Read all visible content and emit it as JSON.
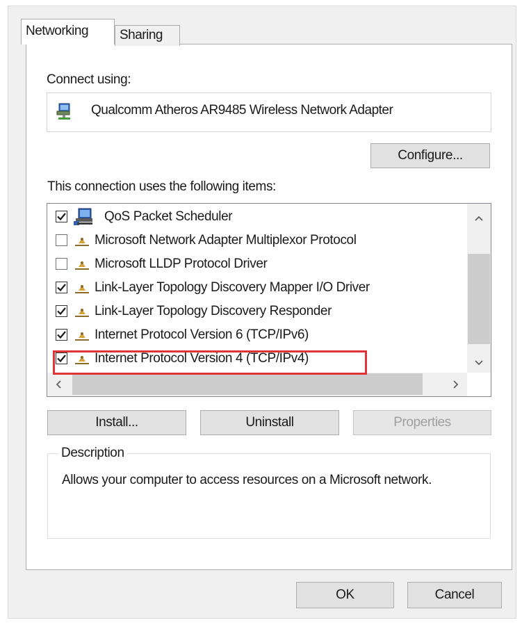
{
  "tabs": [
    {
      "label": "Networking",
      "active": true
    },
    {
      "label": "Sharing",
      "active": false
    }
  ],
  "connect_using": {
    "label": "Connect using:",
    "adapter_name": "Qualcomm Atheros AR9485 Wireless Network Adapter",
    "adapter_icon": "network-adapter-icon",
    "configure_label": "Configure..."
  },
  "items_section": {
    "label": "This connection uses the following items:",
    "items": [
      {
        "label": "QoS Packet Scheduler",
        "checked": true,
        "icon": "qos-scheduler-icon"
      },
      {
        "label": "Microsoft Network Adapter Multiplexor Protocol",
        "checked": false,
        "icon": "protocol-icon"
      },
      {
        "label": "Microsoft LLDP Protocol Driver",
        "checked": false,
        "icon": "protocol-icon"
      },
      {
        "label": "Link-Layer Topology Discovery Mapper I/O Driver",
        "checked": true,
        "icon": "protocol-icon"
      },
      {
        "label": "Link-Layer Topology Discovery Responder",
        "checked": true,
        "icon": "protocol-icon"
      },
      {
        "label": "Internet Protocol Version 6 (TCP/IPv6)",
        "checked": true,
        "icon": "protocol-icon"
      },
      {
        "label": "Internet Protocol Version 4 (TCP/IPv4)",
        "checked": true,
        "icon": "protocol-icon",
        "highlighted": true
      }
    ],
    "highlight_color": "#e0333a"
  },
  "buttons": {
    "install": "Install...",
    "uninstall": "Uninstall",
    "properties": "Properties",
    "properties_disabled": true
  },
  "description": {
    "legend": "Description",
    "text": "Allows your computer to access resources on a Microsoft network."
  },
  "footer": {
    "ok": "OK",
    "cancel": "Cancel"
  }
}
